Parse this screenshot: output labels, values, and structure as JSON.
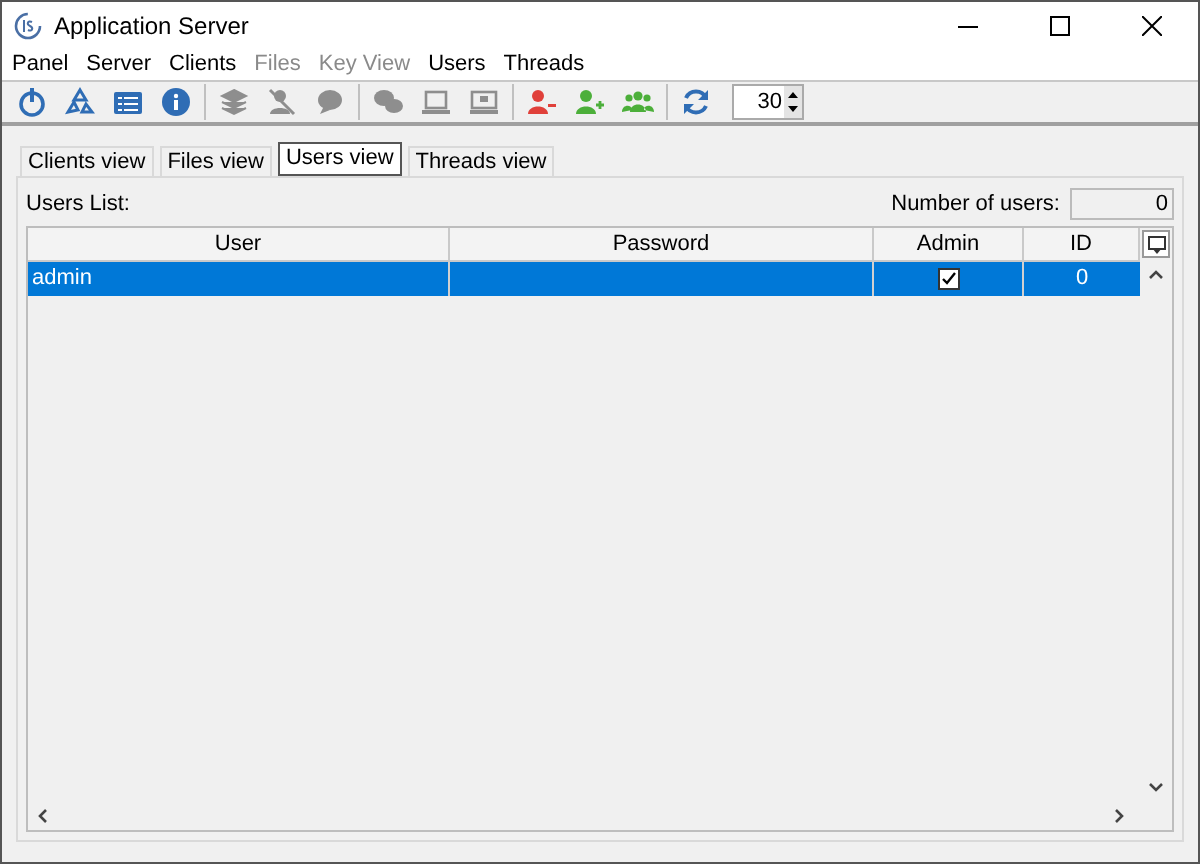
{
  "window": {
    "title": "Application Server"
  },
  "menu": [
    {
      "label": "Panel",
      "disabled": false
    },
    {
      "label": "Server",
      "disabled": false
    },
    {
      "label": "Clients",
      "disabled": false
    },
    {
      "label": "Files",
      "disabled": true
    },
    {
      "label": "Key View",
      "disabled": true
    },
    {
      "label": "Users",
      "disabled": false
    },
    {
      "label": "Threads",
      "disabled": false
    }
  ],
  "toolbar": {
    "buttons": [
      {
        "disabled": false
      },
      {
        "disabled": false
      },
      {
        "disabled": false
      },
      {
        "disabled": false
      },
      {
        "disabled": true
      },
      {
        "disabled": true
      },
      {
        "disabled": true
      },
      {
        "disabled": true
      },
      {
        "disabled": true
      },
      {
        "disabled": true
      },
      {
        "disabled": false
      },
      {
        "disabled": false
      },
      {
        "disabled": false
      },
      {
        "disabled": false
      }
    ],
    "spinner_value": "30"
  },
  "tabs": [
    {
      "label": "Clients view",
      "selected": false
    },
    {
      "label": "Files view",
      "selected": false
    },
    {
      "label": "Users view",
      "selected": true
    },
    {
      "label": "Threads view",
      "selected": false
    }
  ],
  "users_list_label": "Users List:",
  "count_label": "Number of users:",
  "count_value": "0",
  "table": {
    "columns": [
      "User",
      "Password",
      "Admin",
      "ID"
    ],
    "rows": [
      {
        "user": "admin",
        "password": "",
        "admin": true,
        "id": "0",
        "selected": true
      }
    ]
  }
}
